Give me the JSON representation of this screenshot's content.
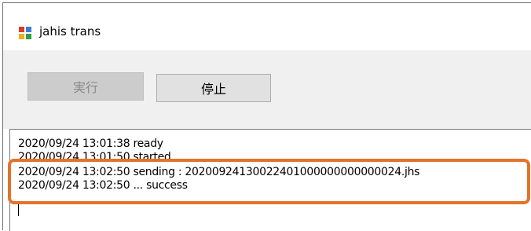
{
  "window": {
    "title": "jahis trans"
  },
  "buttons": {
    "run_label": "実行",
    "stop_label": "停止"
  },
  "log": {
    "lines": [
      "2020/09/24 13:01:38 ready",
      "2020/09/24 13:01:50 started",
      "2020/09/24 13:02:50 sending : 20200924130022401000000000000024.jhs",
      "2020/09/24 13:02:50 ... success"
    ]
  },
  "colors": {
    "highlight": "#e3732a",
    "panel": "#f0f0f0"
  }
}
